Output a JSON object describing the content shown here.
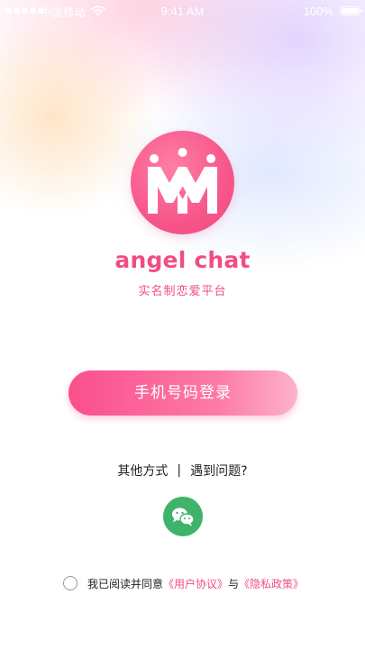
{
  "status_bar": {
    "carrier": "中国移动",
    "time": "9:41 AM",
    "battery": "100%"
  },
  "app": {
    "name": "angel chat",
    "slogan": "实名制恋爱平台",
    "logo_icon": "crown-mm-logo-icon"
  },
  "login": {
    "phone_button": "手机号码登录"
  },
  "other": {
    "other_methods": "其他方式",
    "separator": "|",
    "problem": "遇到问题?",
    "wechat_icon": "wechat-icon"
  },
  "agreement": {
    "prefix": "我已阅读并同意",
    "user_agreement": "《用户协议》",
    "and": "与",
    "privacy_policy": "《隐私政策》"
  },
  "colors": {
    "accent": "#f04e83",
    "wechat": "#3fb36a"
  }
}
